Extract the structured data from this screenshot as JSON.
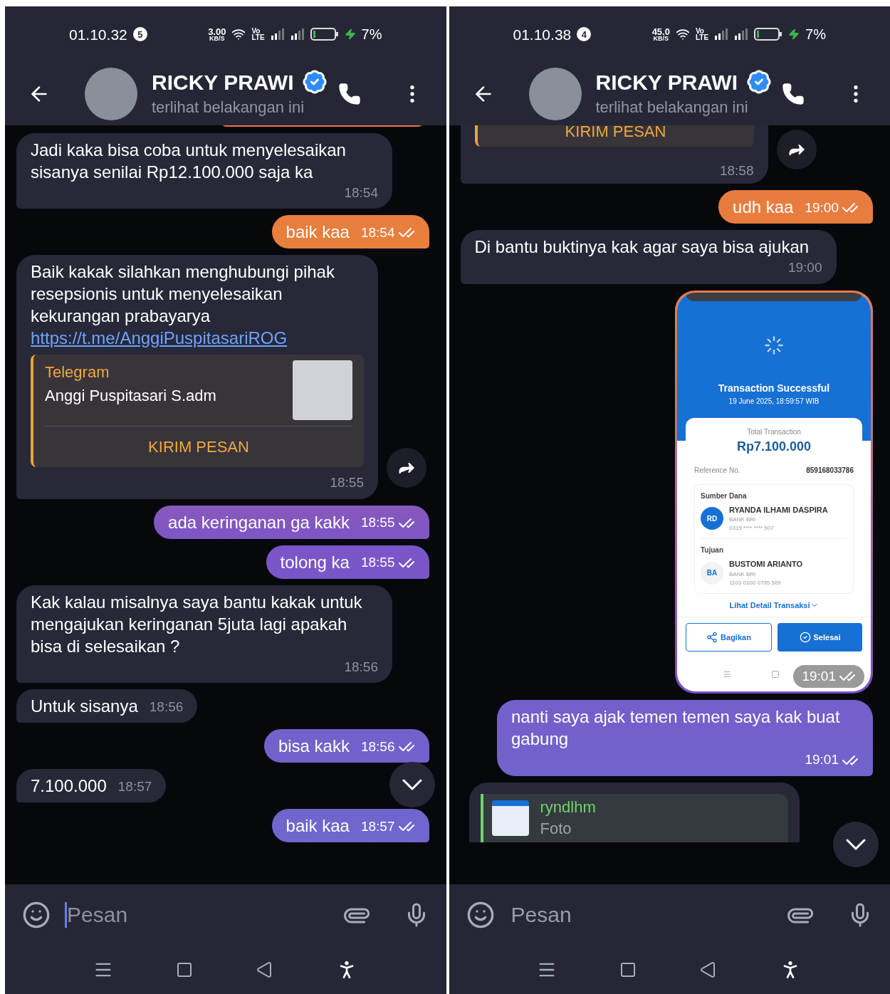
{
  "screens": [
    {
      "status_bar": {
        "time": "01.10.32",
        "notification_count": "5",
        "net_speed": "3.00",
        "net_unit": "KB/S",
        "volte": "Vo",
        "lte": "LTE",
        "battery": "7%"
      },
      "header": {
        "name": "RICKY PRAWI",
        "verified": true,
        "status": "terlihat belakangan ini"
      },
      "messages": [
        {
          "kind": "cut_edge"
        },
        {
          "kind": "text",
          "outgoing": false,
          "text": "Jadi kaka bisa coba untuk menyelesaikan sisanya senilai Rp12.100.000 saja ka",
          "time": "18:54"
        },
        {
          "kind": "text",
          "outgoing": true,
          "text": "baik kaa",
          "time": "18:54",
          "read": true
        },
        {
          "kind": "link_post",
          "text": "Baik kakak silahkan menghubungi pihak resepsionis untuk menyelesaikan kekurangan  prabayarya",
          "link": "https://t.me/AnggiPuspitasariROG",
          "preview": {
            "site": "Telegram",
            "title": "Anggi Puspitasari S.adm",
            "button": "KIRIM PESAN"
          },
          "time": "18:55"
        },
        {
          "kind": "text",
          "outgoing": true,
          "text": "ada keringanan ga kakk",
          "time": "18:55",
          "read": true
        },
        {
          "kind": "text",
          "outgoing": true,
          "text": "tolong ka",
          "time": "18:55",
          "read": true
        },
        {
          "kind": "text",
          "outgoing": false,
          "text": "Kak kalau misalnya saya bantu kakak untuk mengajukan keringanan 5juta lagi apakah bisa di selesaikan ?",
          "time": "18:56"
        },
        {
          "kind": "text",
          "outgoing": false,
          "text": "Untuk sisanya",
          "time": "18:56"
        },
        {
          "kind": "text",
          "outgoing": true,
          "text": "bisa kakk",
          "time": "18:56",
          "read": true
        },
        {
          "kind": "text",
          "outgoing": false,
          "text": "7.100.000",
          "time": "18:57"
        },
        {
          "kind": "text",
          "outgoing": true,
          "text": "baik kaa",
          "time": "18:57",
          "read": true
        }
      ],
      "input": {
        "placeholder": "Pesan",
        "focused": true
      }
    },
    {
      "status_bar": {
        "time": "01.10.38",
        "notification_count": "4",
        "net_speed": "45.0",
        "net_unit": "KB/S",
        "volte": "Vo",
        "lte": "LTE",
        "battery": "7%"
      },
      "header": {
        "name": "RICKY PRAWI",
        "verified": true,
        "status": "terlihat belakangan ini"
      },
      "messages": [
        {
          "kind": "forward_cut",
          "button": "KIRIM PESAN",
          "time": "18:58"
        },
        {
          "kind": "text",
          "outgoing": true,
          "text": "udh kaa",
          "time": "19:00",
          "read": true
        },
        {
          "kind": "text",
          "outgoing": false,
          "text": "Di bantu buktinya kak agar saya bisa ajukan",
          "time": "19:00"
        },
        {
          "kind": "receipt_photo",
          "time": "19:01",
          "read": true,
          "receipt": {
            "title": "Transaction Successful",
            "date": "19 June 2025, 18:59:57 WIB",
            "total_label": "Total Transaction",
            "total": "Rp7.100.000",
            "ref_label": "Reference No.",
            "ref": "859168033786",
            "source_label": "Sumber Dana",
            "source_initials": "RD",
            "source_name": "RYANDA ILHAMI DASPIRA",
            "source_bank": "BANK BRI",
            "source_account": "0315 **** **** 507",
            "dest_label": "Tujuan",
            "dest_initials": "BA",
            "dest_name": "BUSTOMI ARIANTO",
            "dest_bank": "BANK BRI",
            "dest_account": "1103 0100 0795 569",
            "detail_link": "Lihat Detail Transaksi",
            "share_button": "Bagikan",
            "done_button": "Selesai"
          }
        },
        {
          "kind": "text",
          "outgoing": true,
          "text": "nanti saya ajak temen temen saya kak buat gabung",
          "time": "19:01",
          "read": true
        },
        {
          "kind": "reply_cut",
          "reply_name": "ryndlhm",
          "reply_text": "Foto"
        }
      ],
      "input": {
        "placeholder": "Pesan",
        "focused": false
      }
    }
  ]
}
